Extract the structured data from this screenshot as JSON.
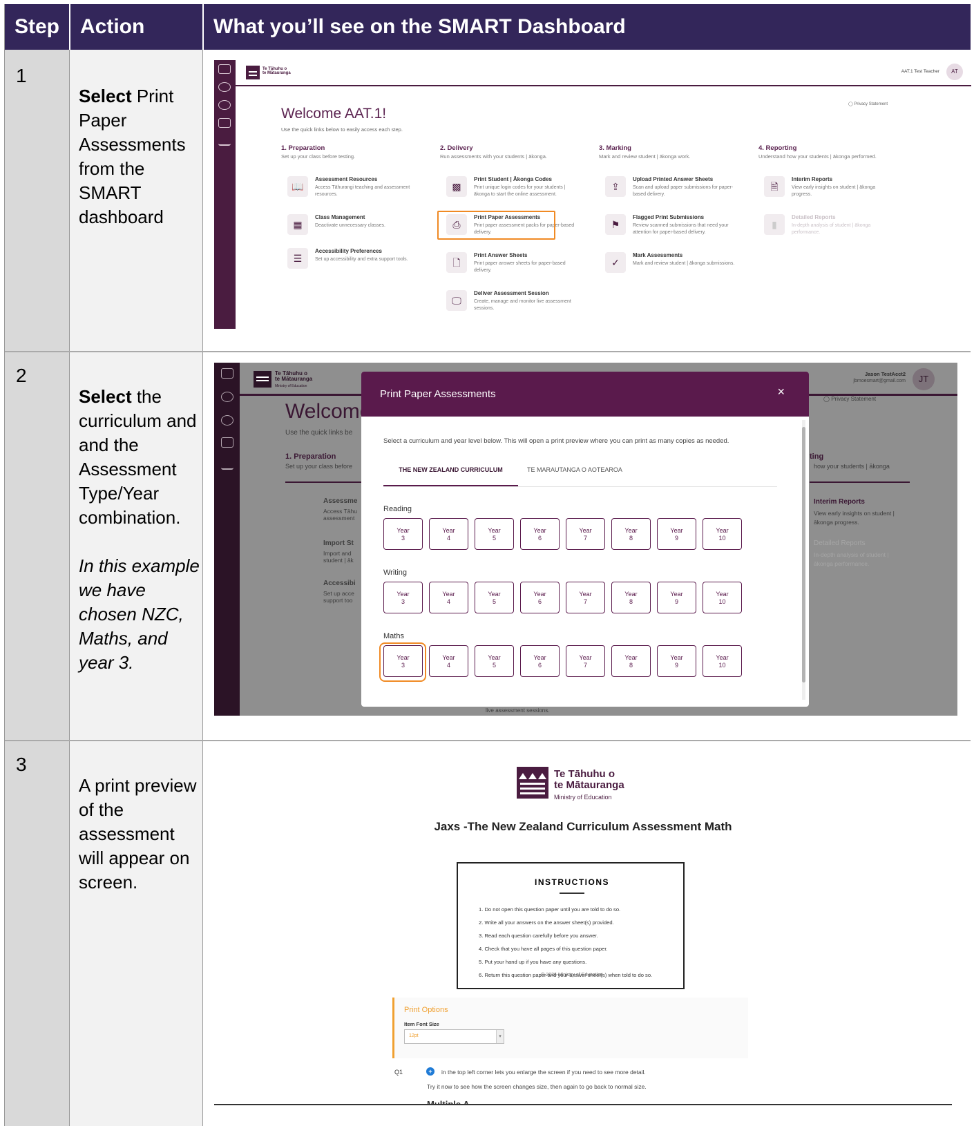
{
  "header": {
    "step": "Step",
    "action": "Action",
    "see": "What you’ll see on the SMART Dashboard"
  },
  "rows": [
    {
      "step": "1",
      "action_bold": "Select",
      "action_rest": " Print Paper Assessments from the SMART dashboard"
    },
    {
      "step": "2",
      "action_bold": "Select",
      "action_rest": " the curriculum and and the Assessment Type/Year combination.",
      "action_italic": "In this example we have chosen NZC, Maths, and year 3."
    },
    {
      "step": "3",
      "action_rest": "A print preview of the assessment will appear on screen."
    }
  ],
  "shot1": {
    "logo_line1": "Te Tāhuhu o",
    "logo_line2": "te Mātauranga",
    "user": "AAT.1 Test Teacher",
    "avatar": "AT",
    "privacy": "Privacy Statement",
    "welcome": "Welcome AAT.1!",
    "welcome_sub": "Use the quick links below to easily access each step.",
    "columns": [
      {
        "title": "1. Preparation",
        "sub": "Set up your class before testing.",
        "cards": [
          {
            "icon": "book-icon",
            "glyph": "📖",
            "title": "Assessment Resources",
            "desc": "Access Tāhurangi teaching and assessment resources."
          },
          {
            "icon": "grid-icon",
            "glyph": "▦",
            "title": "Class Management",
            "desc": "Deactivate unnecessary classes."
          },
          {
            "icon": "sliders-icon",
            "glyph": "☰",
            "title": "Accessibility Preferences",
            "desc": "Set up accessibility and extra support tools."
          }
        ]
      },
      {
        "title": "2. Delivery",
        "sub": "Run assessments with your students | ākonga.",
        "cards": [
          {
            "icon": "qr-icon",
            "glyph": "▩",
            "title": "Print Student | Ākonga Codes",
            "desc": "Print unique login codes for your students | ākonga to start the online assessment."
          },
          {
            "icon": "printer-icon",
            "glyph": "⎙",
            "title": "Print Paper Assessments",
            "desc": "Print paper assessment packs for paper-based delivery."
          },
          {
            "icon": "file-icon",
            "glyph": "🗋",
            "title": "Print Answer Sheets",
            "desc": "Print paper answer sheets for paper-based delivery."
          },
          {
            "icon": "monitor-icon",
            "glyph": "🖵",
            "title": "Deliver Assessment Session",
            "desc": "Create, manage and monitor live assessment sessions."
          }
        ]
      },
      {
        "title": "3. Marking",
        "sub": "Mark and review student | ākonga work.",
        "cards": [
          {
            "icon": "upload-icon",
            "glyph": "⇪",
            "title": "Upload Printed Answer Sheets",
            "desc": "Scan and upload paper submissions for paper-based delivery."
          },
          {
            "icon": "flag-file-icon",
            "glyph": "⚑",
            "title": "Flagged Print Submissions",
            "desc": "Review scanned submissions that need your attention for paper-based delivery."
          },
          {
            "icon": "check-circle-icon",
            "glyph": "✓",
            "title": "Mark Assessments",
            "desc": "Mark and review student | ākonga submissions."
          }
        ]
      },
      {
        "title": "4. Reporting",
        "sub": "Understand how your students | ākonga performed.",
        "cards": [
          {
            "icon": "report-icon",
            "glyph": "🗎",
            "title": "Interim Reports",
            "desc": "View early insights on student | ākonga progress."
          },
          {
            "icon": "bar-chart-icon",
            "glyph": "▮",
            "title": "Detailed Reports",
            "desc": "In-depth analysis of student | ākonga performance."
          }
        ]
      }
    ]
  },
  "shot2": {
    "logo_line1": "Te Tāhuhu o",
    "logo_line2": "te Mātauranga",
    "logo_line3": "Ministry of Education",
    "user": "Jason TestAcct2",
    "email": "jbmoesmart@gmail.com",
    "avatar": "JT",
    "privacy": "Privacy Statement",
    "welcome": "Welcome",
    "welcome_sub": "Use the quick links be",
    "prep": "1. Preparation",
    "prep_sub": "Set up your class before",
    "bg_cards": [
      "Assessme",
      "Import St",
      "Accessibi"
    ],
    "bg_cards_desc": [
      "Access Tāhu assessment",
      "Import and student | āk",
      "Set up acce support too"
    ],
    "reporting_cut": "ting",
    "reporting_sub": "how your students | ākonga",
    "interim": "Interim Reports",
    "interim_desc": "View early insights on student | ākonga progress.",
    "detailed": "Detailed Reports",
    "detailed_desc": "In-depth analysis of student | ākonga performance.",
    "bottom_cut": "live assessment sessions.",
    "modal": {
      "title": "Print Paper Assessments",
      "close": "×",
      "intro": "Select a curriculum and year level below. This will open a print preview where you can print as many copies as needed.",
      "tabs": [
        "THE NEW ZEALAND CURRICULUM",
        "TE MARAUTANGA O AOTEAROA"
      ],
      "sections": [
        "Reading",
        "Writing",
        "Maths"
      ],
      "year_word": "Year",
      "years": [
        "3",
        "4",
        "5",
        "6",
        "7",
        "8",
        "9",
        "10"
      ],
      "selected": {
        "section": "Maths",
        "year": "3"
      }
    }
  },
  "shot3": {
    "logo_line1": "Te Tāhuhu o",
    "logo_line2": "te Mātauranga",
    "logo_line3": "Ministry of Education",
    "title": "Jaxs -The New Zealand Curriculum Assessment Math",
    "instructions_heading": "INSTRUCTIONS",
    "instructions": [
      "1. Do not open this question paper until you are told to do so.",
      "2. Write all your answers on the answer sheet(s) provided.",
      "3. Read each question carefully before you answer.",
      "4. Check that you have all pages of this question paper.",
      "5. Put your hand up if you have any questions.",
      "6. Return this question paper and your answer sheet(s) when told to do so."
    ],
    "copyright": "© 2026 Ministry of Education",
    "print_options": "Print Options",
    "font_size_label": "Item Font Size",
    "font_size_value": "12pt",
    "q_label": "Q1",
    "q_icon": "+",
    "q_text1": "in the top left corner lets you enlarge the screen if you need to see more detail.",
    "q_text2": "Try it now to see how the screen changes size, then again to go back to normal size.",
    "q_cut": "Multiple A"
  },
  "colors": {
    "header_bg": "#33265a",
    "brand": "#4a1c40",
    "highlight": "#f08a24"
  }
}
